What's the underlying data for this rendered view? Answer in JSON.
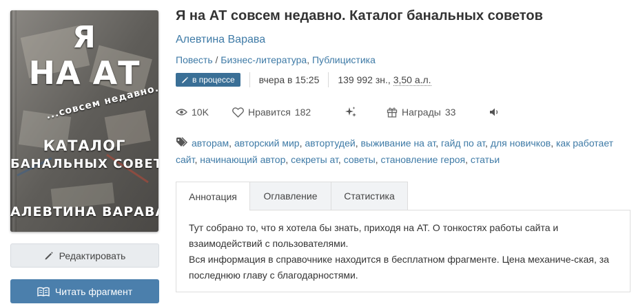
{
  "cover": {
    "line1": "Я",
    "line2": "НА АТ",
    "line3": "...совсем недавно...",
    "line4": "КАТАЛОГ",
    "line5": "БАНАЛЬНЫХ СОВЕТОВ",
    "line6": "АЛЕВТИНА ВАРАВА"
  },
  "buttons": {
    "edit_label": "Редактировать",
    "read_label": "Читать фрагмент"
  },
  "book": {
    "title": "Я на АТ совсем недавно. Каталог банальных советов",
    "author": "Алевтина Варава",
    "genre_type": "Повесть",
    "genre_separator": "/",
    "genres": [
      "Бизнес-литература",
      "Публицистика"
    ],
    "status": "в процессе",
    "updated": "вчера в 15:25",
    "size_chars": "139 992 зн.",
    "size_sheets": "3,50 а.л."
  },
  "stats": {
    "views": "10K",
    "likes_label": "Нравится",
    "likes_count": "182",
    "awards_label": "Награды",
    "awards_count": "33"
  },
  "tags": [
    "авторам",
    "авторский мир",
    "автортудей",
    "выживание на ат",
    "гайд по ат",
    "для новичков",
    "как работает сайт",
    "начинающий автор",
    "секреты ат",
    "советы",
    "становление героя",
    "статьи"
  ],
  "tabs": [
    {
      "label": "Аннотация",
      "active": true
    },
    {
      "label": "Оглавление",
      "active": false
    },
    {
      "label": "Статистика",
      "active": false
    }
  ],
  "annotation": {
    "paragraph1": "Тут собрано то, что я хотела бы знать, приходя на АТ. О тонкостях работы сайта и взаимодействий с пользователями.",
    "paragraph2": "Вся информация в справочнике находится в бесплатном фрагменте. Цена механиче-ская, за последнюю главу с благодарностями."
  },
  "colors": {
    "link": "#3e7aa6",
    "status_badge": "#3a6f96",
    "read_button": "#4b7fac",
    "edit_button": "#e9ecef"
  }
}
